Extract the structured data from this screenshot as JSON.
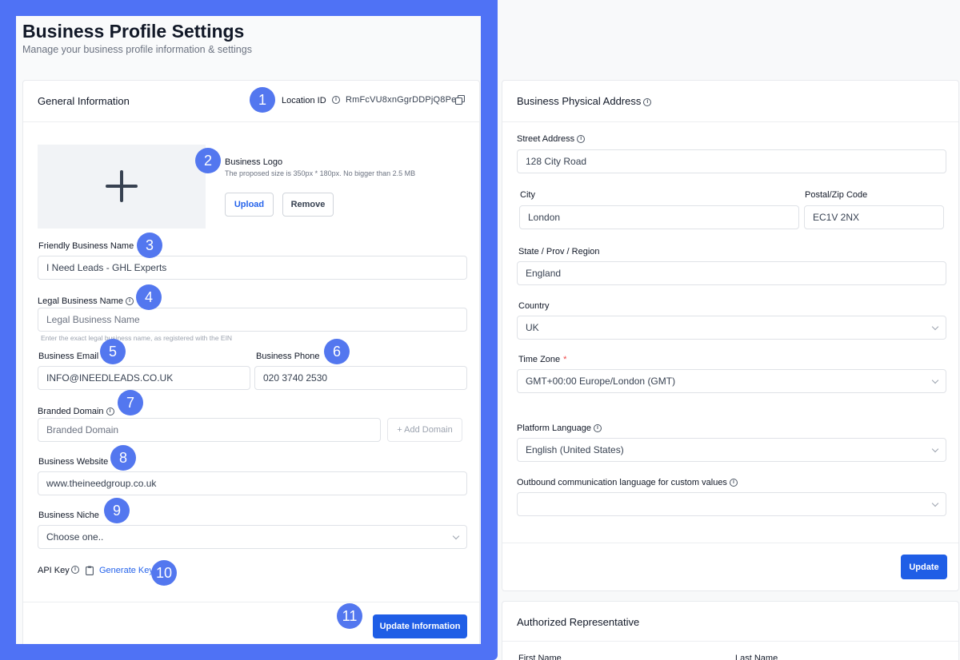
{
  "page": {
    "title": "Business Profile Settings",
    "subtitle": "Manage your business profile information & settings"
  },
  "general": {
    "title": "General Information",
    "location_label": "Location ID",
    "location_id": "RmFcVU8xnGgrDDPjQ8Pe",
    "logo_title": "Business Logo",
    "logo_hint": "The proposed size is 350px * 180px. No bigger than 2.5 MB",
    "upload_label": "Upload",
    "remove_label": "Remove",
    "friendly_name_label": "Friendly Business Name",
    "friendly_name_value": "I Need Leads - GHL Experts",
    "legal_name_label": "Legal Business Name",
    "legal_name_placeholder": "Legal Business Name",
    "legal_name_hint": "Enter the exact legal business name, as registered with the EIN",
    "email_label": "Business Email",
    "email_value": "INFO@INEEDLEADS.CO.UK",
    "phone_label": "Business Phone",
    "phone_value": "020 3740 2530",
    "domain_label": "Branded Domain",
    "domain_placeholder": "Branded Domain",
    "add_domain_label": "+ Add Domain",
    "website_label": "Business Website",
    "website_value": "www.theineedgroup.co.uk",
    "niche_label": "Business Niche",
    "niche_value": "Choose one..",
    "api_key_label": "API Key",
    "generate_key_label": "Generate Key",
    "update_info_label": "Update Information"
  },
  "address": {
    "title": "Business Physical Address",
    "street_label": "Street Address",
    "street_value": "128 City Road",
    "city_label": "City",
    "city_value": "London",
    "postal_label": "Postal/Zip Code",
    "postal_value": "EC1V 2NX",
    "state_label": "State / Prov / Region",
    "state_value": "England",
    "country_label": "Country",
    "country_value": "UK",
    "timezone_label": "Time Zone",
    "timezone_required": "*",
    "timezone_value": "GMT+00:00 Europe/London (GMT)",
    "platform_lang_label": "Platform Language",
    "platform_lang_value": "English (United States)",
    "outbound_lang_label": "Outbound communication language for custom values",
    "outbound_lang_value": "",
    "update_label": "Update"
  },
  "authorized": {
    "title": "Authorized Representative",
    "first_name_label": "First Name",
    "last_name_label": "Last Name"
  },
  "badges": [
    "1",
    "2",
    "3",
    "4",
    "5",
    "6",
    "7",
    "8",
    "9",
    "10",
    "11"
  ],
  "colors": {
    "highlight_frame": "#4f72f5",
    "badge": "#5377ef",
    "primary_button": "#1f5ee6",
    "link": "#2563eb"
  }
}
